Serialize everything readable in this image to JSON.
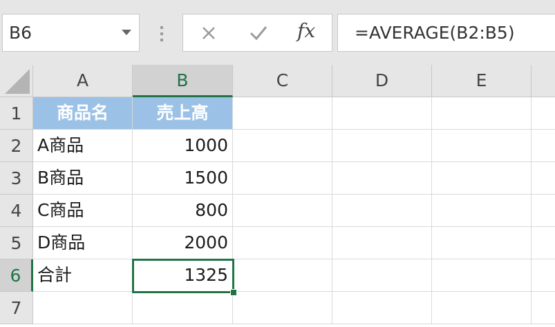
{
  "name_box": {
    "value": "B6"
  },
  "formula_bar": {
    "cancel_icon": "close-icon",
    "enter_icon": "check-icon",
    "fx_label": "fx",
    "formula": "=AVERAGE(B2:B5)"
  },
  "columns": [
    "A",
    "B",
    "C",
    "D",
    "E"
  ],
  "rows": [
    "1",
    "2",
    "3",
    "4",
    "5",
    "6",
    "7"
  ],
  "selected_cell": "B6",
  "cells": {
    "a1": "商品名",
    "b1": "売上高",
    "a2": "A商品",
    "b2": "1000",
    "a3": "B商品",
    "b3": "1500",
    "a4": "C商品",
    "b4": "800",
    "a5": "D商品",
    "b5": "2000",
    "a6": "合計",
    "b6": "1325"
  },
  "colors": {
    "header_fill": "#9bc2e6",
    "selection": "#217346",
    "chrome": "#e6e6e6"
  }
}
